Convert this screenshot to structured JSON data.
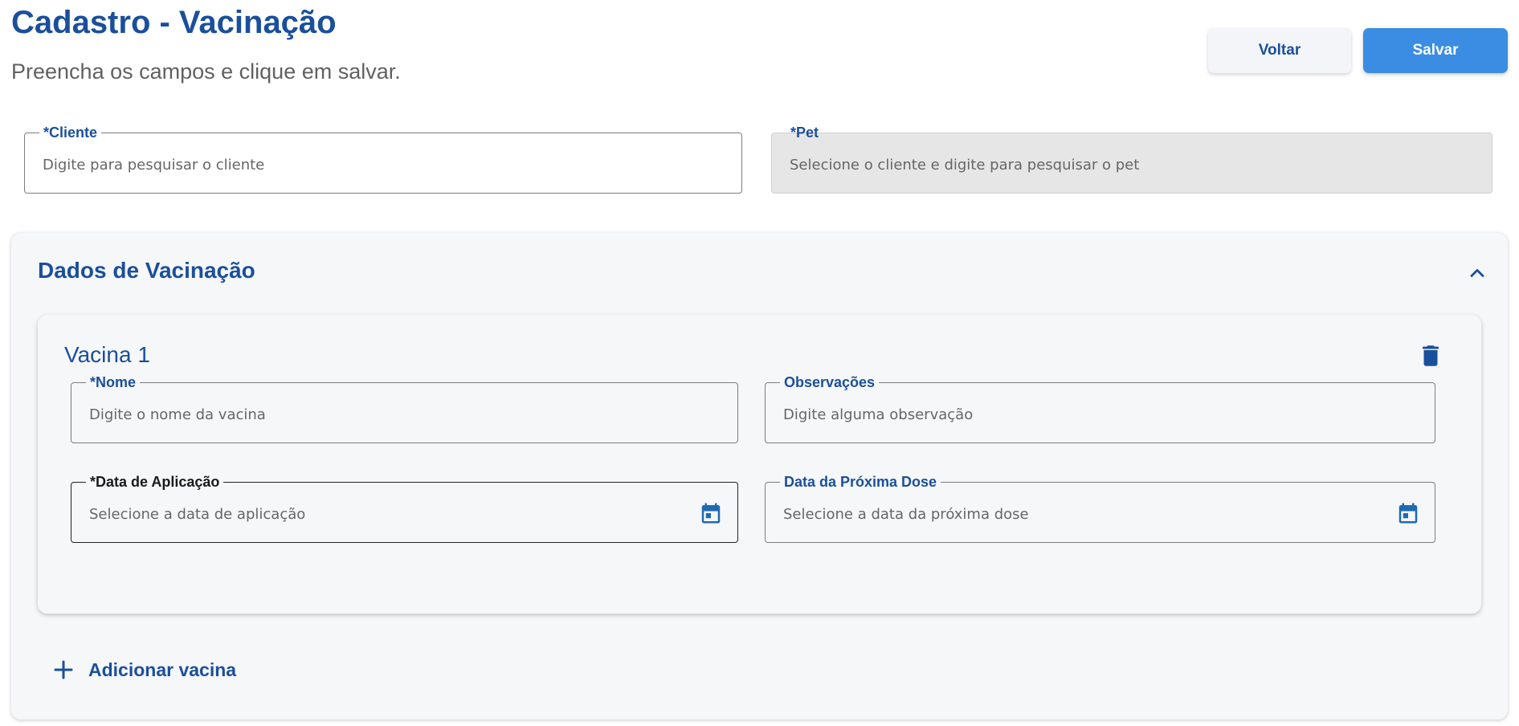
{
  "header": {
    "title": "Cadastro - Vacinação",
    "subtitle": "Preencha os campos e clique em salvar."
  },
  "actions": {
    "back_label": "Voltar",
    "save_label": "Salvar"
  },
  "client_field": {
    "label": "*Cliente",
    "placeholder": "Digite para pesquisar o cliente",
    "value": ""
  },
  "pet_field": {
    "label": "*Pet",
    "placeholder": "Selecione o cliente e digite para pesquisar o pet",
    "value": "",
    "disabled": true
  },
  "vaccination_section": {
    "title": "Dados de Vacinação",
    "expanded": true,
    "vaccines": [
      {
        "title": "Vacina 1",
        "name": {
          "label": "*Nome",
          "placeholder": "Digite o nome da vacina",
          "value": ""
        },
        "notes": {
          "label": "Observações",
          "placeholder": "Digite alguma observação",
          "value": ""
        },
        "application_date": {
          "label": "*Data de Aplicação",
          "placeholder": "Selecione a data de aplicação",
          "value": ""
        },
        "next_dose_date": {
          "label": "Data da Próxima Dose",
          "placeholder": "Selecione a data da próxima dose",
          "value": ""
        }
      }
    ],
    "add_label": "Adicionar vacina"
  },
  "icons": {
    "collapse": "chevron-up-icon",
    "delete": "trash-icon",
    "calendar": "calendar-icon",
    "add": "plus-icon"
  },
  "colors": {
    "primary": "#1a4f9c",
    "accent_button": "#3a8de2",
    "panel_bg": "#f6f7f9",
    "disabled_bg": "#e6e6e6"
  }
}
